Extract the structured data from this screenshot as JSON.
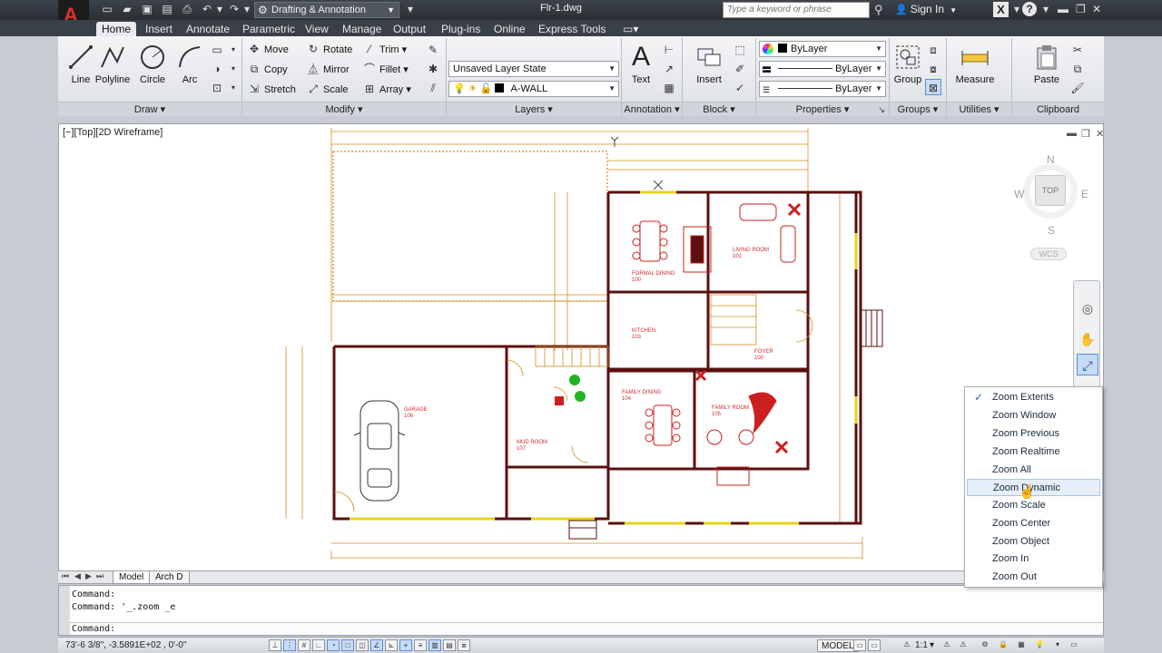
{
  "title_bar": {
    "workspace": "Drafting & Annotation",
    "document": "Flr-1.dwg",
    "search_placeholder": "Type a keyword or phrase",
    "sign_in": "Sign In"
  },
  "ribbon_tabs": [
    "Home",
    "Insert",
    "Annotate",
    "Parametric",
    "View",
    "Manage",
    "Output",
    "Plug-ins",
    "Online",
    "Express Tools"
  ],
  "active_tab": "Home",
  "draw_panel": {
    "title": "Draw",
    "tools": [
      "Line",
      "Polyline",
      "Circle",
      "Arc"
    ]
  },
  "modify_panel": {
    "title": "Modify",
    "col1": [
      "Move",
      "Copy",
      "Stretch"
    ],
    "col2": [
      "Rotate",
      "Mirror",
      "Scale"
    ],
    "col3": [
      "Trim",
      "Fillet",
      "Array"
    ]
  },
  "layers_panel": {
    "title": "Layers",
    "layer_state": "Unsaved Layer State",
    "current_layer": "A-WALL"
  },
  "annotation_panel": {
    "title": "Annotation",
    "text_label": "Text"
  },
  "block_panel": {
    "title": "Block",
    "insert_label": "Insert"
  },
  "properties_panel": {
    "title": "Properties",
    "color": "ByLayer",
    "linetype": "ByLayer",
    "lineweight": "ByLayer"
  },
  "groups_panel": {
    "title": "Groups",
    "group_label": "Group"
  },
  "utilities_panel": {
    "title": "Utilities",
    "measure_label": "Measure"
  },
  "clipboard_panel": {
    "title": "Clipboard",
    "paste_label": "Paste"
  },
  "viewport": {
    "label": "[−][Top][2D Wireframe]",
    "viewcube": {
      "north": "N",
      "south": "S",
      "east": "E",
      "west": "W",
      "top": "TOP",
      "wcs": "WCS"
    }
  },
  "zoom_menu": {
    "items": [
      "Zoom Extents",
      "Zoom Window",
      "Zoom Previous",
      "Zoom Realtime",
      "Zoom All",
      "Zoom Dynamic",
      "Zoom Scale",
      "Zoom Center",
      "Zoom Object",
      "Zoom In",
      "Zoom Out"
    ],
    "checked": "Zoom Extents",
    "hovered": "Zoom Dynamic"
  },
  "floor_plan": {
    "rooms": [
      {
        "name": "GARAGE",
        "number": "106"
      },
      {
        "name": "MUD ROOM",
        "number": "107"
      },
      {
        "name": "FORMAL DINING",
        "number": "100"
      },
      {
        "name": "LIVING ROOM",
        "number": "101"
      },
      {
        "name": "KITCHEN",
        "number": "103"
      },
      {
        "name": "FOYER",
        "number": "100"
      },
      {
        "name": "FAMILY DINING",
        "number": "104"
      },
      {
        "name": "FAMILY ROOM",
        "number": "105"
      }
    ],
    "colors": {
      "walls": "#5c0f0f",
      "dims": "#d48c1a",
      "furniture": "#cc1f1f",
      "plants": "#1fb51f"
    }
  },
  "layout_tabs": [
    "Model",
    "Arch D"
  ],
  "command_lines": [
    "Command:",
    "Command:  '_.zoom _e"
  ],
  "command_prompt": "Command:",
  "status_bar": {
    "coords": "73'-6 3/8\",  -3.5891E+02 , 0'-0\"",
    "model": "MODEL",
    "scale": "1:1"
  }
}
